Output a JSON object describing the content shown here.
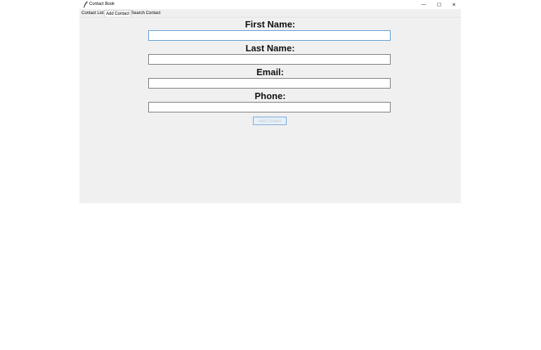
{
  "window": {
    "title": "Contact Book",
    "controls": {
      "minimize": "—",
      "maximize": "☐",
      "close": "✕"
    }
  },
  "tabs": [
    {
      "label": "Contact List",
      "active": false
    },
    {
      "label": "Add Contact",
      "active": true
    },
    {
      "label": "Search Contact",
      "active": false
    }
  ],
  "form": {
    "first_name": {
      "label": "First Name:",
      "value": ""
    },
    "last_name": {
      "label": "Last Name:",
      "value": ""
    },
    "email": {
      "label": "Email:",
      "value": ""
    },
    "phone": {
      "label": "Phone:",
      "value": ""
    },
    "submit_label": "Add Contact"
  },
  "colors": {
    "window_bg": "#f0f0f0",
    "focus_border": "#5b9bd5",
    "button_bg": "#e5f1fb"
  }
}
